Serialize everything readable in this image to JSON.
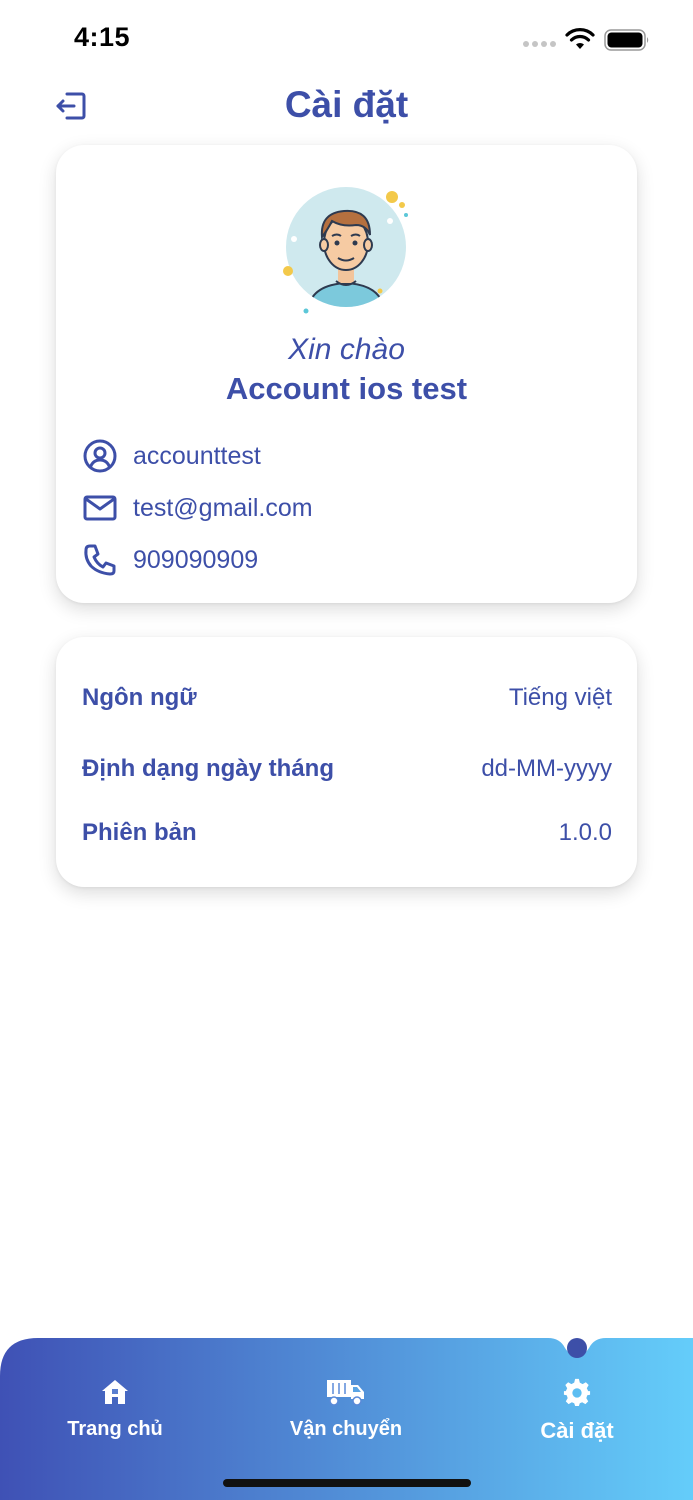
{
  "status_bar": {
    "time": "4:15"
  },
  "header": {
    "title": "Cài đặt",
    "logout_icon": "logout-icon"
  },
  "profile": {
    "greeting": "Xin chào",
    "name": "Account ios test",
    "username": "accounttest",
    "email": "test@gmail.com",
    "phone": "909090909"
  },
  "settings": {
    "language_label": "Ngôn ngữ",
    "language_value": "Tiếng việt",
    "date_format_label": "Định dạng ngày tháng",
    "date_format_value": "dd-MM-yyyy",
    "version_label": "Phiên bản",
    "version_value": "1.0.0"
  },
  "nav": {
    "home": "Trang chủ",
    "shipping": "Vận chuyển",
    "settings": "Cài đặt",
    "active": "settings"
  },
  "colors": {
    "primary": "#3d4fa8",
    "nav_gradient_start": "#3f51b5",
    "nav_gradient_end": "#64cdfa"
  }
}
